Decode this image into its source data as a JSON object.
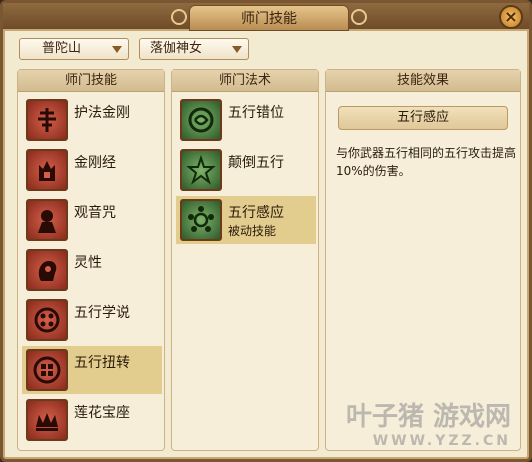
{
  "window": {
    "title": "师门技能",
    "close_label": "×"
  },
  "filters": {
    "sect": "普陀山",
    "master": "落伽神女"
  },
  "panels": {
    "skills_header": "师门技能",
    "spells_header": "师门法术",
    "effect_header": "技能效果"
  },
  "skills": [
    {
      "label": "护法金刚",
      "icon": "guardian-icon"
    },
    {
      "label": "金刚经",
      "icon": "scripture-icon"
    },
    {
      "label": "观音咒",
      "icon": "bodhisattva-icon"
    },
    {
      "label": "灵性",
      "icon": "spirit-head-icon"
    },
    {
      "label": "五行学说",
      "icon": "five-elements-icon"
    },
    {
      "label": "五行扭转",
      "icon": "element-twist-icon"
    },
    {
      "label": "莲花宝座",
      "icon": "lotus-throne-icon"
    }
  ],
  "selected_skill_index": 5,
  "spells": [
    {
      "label": "五行错位",
      "sub": "",
      "icon": "element-shift-icon"
    },
    {
      "label": "颠倒五行",
      "sub": "",
      "icon": "star-pentagram-icon"
    },
    {
      "label": "五行感应",
      "sub": "被动技能",
      "icon": "element-sense-icon"
    }
  ],
  "selected_spell_index": 2,
  "effect": {
    "name": "五行感应",
    "description": "与你武器五行相同的五行攻击提高10%的伤害。"
  },
  "watermark": {
    "brand": "叶子猪 游戏网",
    "url": "WWW.YZZ.CN"
  },
  "colors": {
    "accent": "#e3cd8e",
    "frame": "#7a5632",
    "icon_red": "#8b2a1c",
    "icon_green": "#2d5a2a"
  }
}
